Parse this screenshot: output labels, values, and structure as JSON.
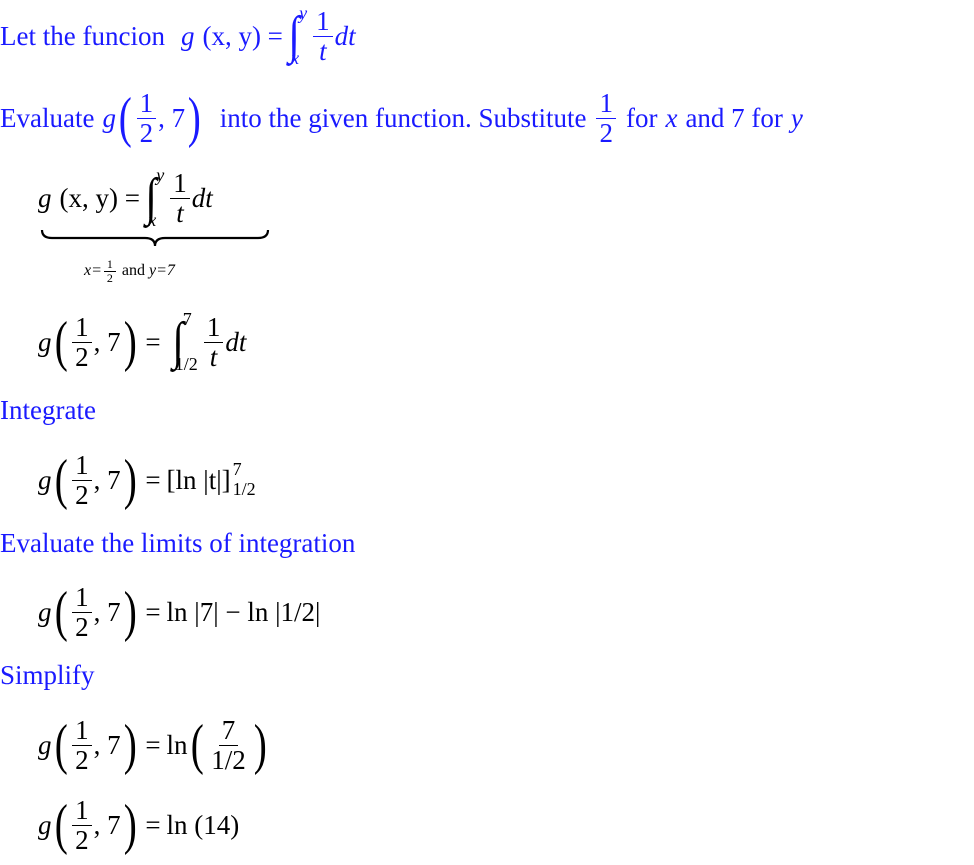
{
  "steps": {
    "intro": {
      "text": "Let the funcion",
      "func": "g",
      "args": "(x, y) =",
      "upper": "y",
      "lower": "x",
      "num": "1",
      "den": "t",
      "dt": "dt"
    },
    "evaluate": {
      "text1": "Evaluate",
      "func": "g",
      "num": "1",
      "den": "2",
      "second": ", 7",
      "text2": "into the given function. Substitute",
      "sub_num": "1",
      "sub_den": "2",
      "text3": "for",
      "var_x": "x",
      "text4": "and 7 for",
      "var_y": "y"
    },
    "eq1": {
      "func": "g",
      "args": "(x, y) =",
      "upper": "y",
      "lower": "x",
      "num": "1",
      "den": "t",
      "dt": "dt",
      "under_x": "x=",
      "under_num": "1",
      "under_den": "2",
      "under_and": "and",
      "under_y": "y=7"
    },
    "eq2": {
      "lhs_func": "g",
      "lhs_num": "1",
      "lhs_den": "2",
      "lhs_second": ", 7",
      "eq": "=",
      "upper": "7",
      "lower": "1/2",
      "num": "1",
      "den": "t",
      "dt": "dt"
    },
    "integrate": {
      "label": "Integrate"
    },
    "eq3": {
      "lhs_func": "g",
      "lhs_num": "1",
      "lhs_den": "2",
      "lhs_second": ", 7",
      "eq": "=",
      "rhs": "[ln |t|]",
      "upper": "7",
      "lower": "1/2"
    },
    "limits": {
      "label": "Evaluate the limits of integration"
    },
    "eq4": {
      "lhs_func": "g",
      "lhs_num": "1",
      "lhs_den": "2",
      "lhs_second": ", 7",
      "eq": "=",
      "rhs": "ln |7| − ln |1/2|"
    },
    "simplify": {
      "label": "Simplify"
    },
    "eq5": {
      "lhs_func": "g",
      "lhs_num": "1",
      "lhs_den": "2",
      "lhs_second": ", 7",
      "eq": "=",
      "ln": "ln",
      "num": "7",
      "den": "1/2"
    },
    "eq6": {
      "lhs_func": "g",
      "lhs_num": "1",
      "lhs_den": "2",
      "lhs_second": ", 7",
      "eq": "=",
      "rhs": "ln (14)"
    }
  },
  "colors": {
    "text_blue": "#1a1aff",
    "math_black": "#000000"
  }
}
